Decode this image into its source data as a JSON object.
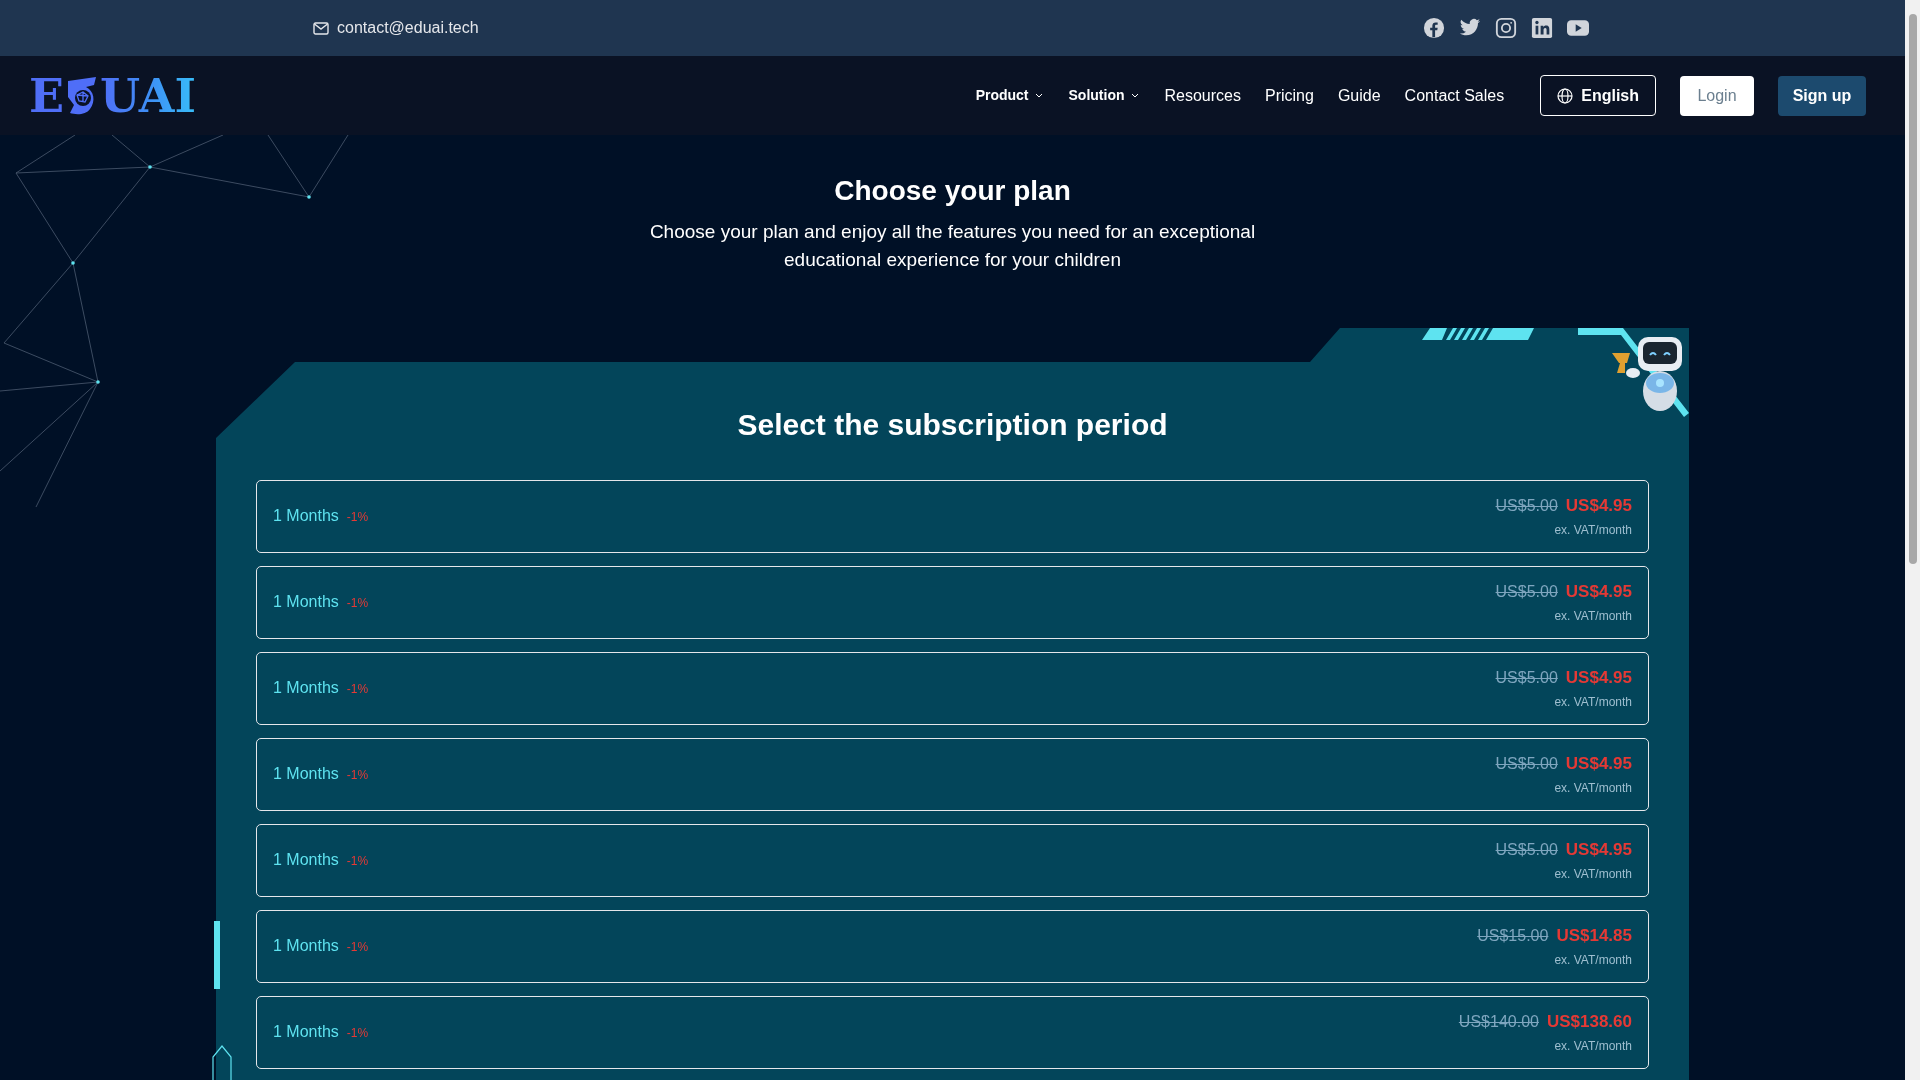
{
  "top_bar": {
    "email": "contact@eduai.tech"
  },
  "logo": {
    "before": "E",
    "after": "UAI"
  },
  "nav": [
    {
      "label": "Product",
      "kind": "dropdown"
    },
    {
      "label": "Solution",
      "kind": "dropdown"
    },
    {
      "label": "Resources",
      "kind": "link"
    },
    {
      "label": "Pricing",
      "kind": "link"
    },
    {
      "label": "Guide",
      "kind": "link"
    },
    {
      "label": "Contact Sales",
      "kind": "link"
    }
  ],
  "language_button": "English",
  "login_button": "Login",
  "signup_button": "Sign up",
  "hero": {
    "title": "Choose your plan",
    "subtitle": "Choose your plan and enjoy all the features you need for an exceptional educational experience for your children"
  },
  "panel": {
    "title": "Select the subscription period",
    "plans": [
      {
        "duration": "1 Months",
        "discount": "-1%",
        "old_price": "US$5.00",
        "price": "US$4.95",
        "note": "ex. VAT/month"
      },
      {
        "duration": "1 Months",
        "discount": "-1%",
        "old_price": "US$5.00",
        "price": "US$4.95",
        "note": "ex. VAT/month"
      },
      {
        "duration": "1 Months",
        "discount": "-1%",
        "old_price": "US$5.00",
        "price": "US$4.95",
        "note": "ex. VAT/month"
      },
      {
        "duration": "1 Months",
        "discount": "-1%",
        "old_price": "US$5.00",
        "price": "US$4.95",
        "note": "ex. VAT/month"
      },
      {
        "duration": "1 Months",
        "discount": "-1%",
        "old_price": "US$5.00",
        "price": "US$4.95",
        "note": "ex. VAT/month"
      },
      {
        "duration": "1 Months",
        "discount": "-1%",
        "old_price": "US$15.00",
        "price": "US$14.85",
        "note": "ex. VAT/month"
      },
      {
        "duration": "1 Months",
        "discount": "-1%",
        "old_price": "US$140.00",
        "price": "US$138.60",
        "note": "ex. VAT/month"
      }
    ]
  }
}
